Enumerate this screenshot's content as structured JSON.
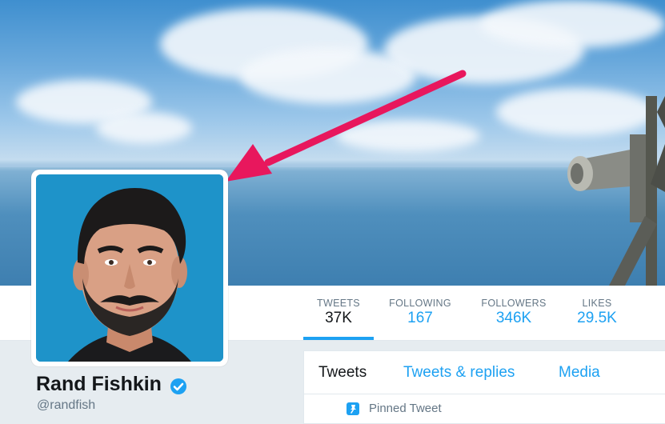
{
  "profile": {
    "name": "Rand Fishkin",
    "handle": "@randfish",
    "verified_icon": "verified-badge-icon"
  },
  "stats": [
    {
      "label": "TWEETS",
      "value": "37K",
      "active": true
    },
    {
      "label": "FOLLOWING",
      "value": "167",
      "active": false
    },
    {
      "label": "FOLLOWERS",
      "value": "346K",
      "active": false
    },
    {
      "label": "LIKES",
      "value": "29.5K",
      "active": false
    }
  ],
  "tabs": [
    {
      "label": "Tweets",
      "active": true
    },
    {
      "label": "Tweets & replies",
      "active": false
    },
    {
      "label": "Media",
      "active": false
    }
  ],
  "pinned": {
    "label": "Pinned Tweet",
    "icon": "pin-icon"
  },
  "colors": {
    "accent": "#1da1f2",
    "arrow": "#e8175d",
    "avatar_bg": "#1e93c9",
    "text_dark": "#14171a",
    "text_muted": "#657786"
  }
}
